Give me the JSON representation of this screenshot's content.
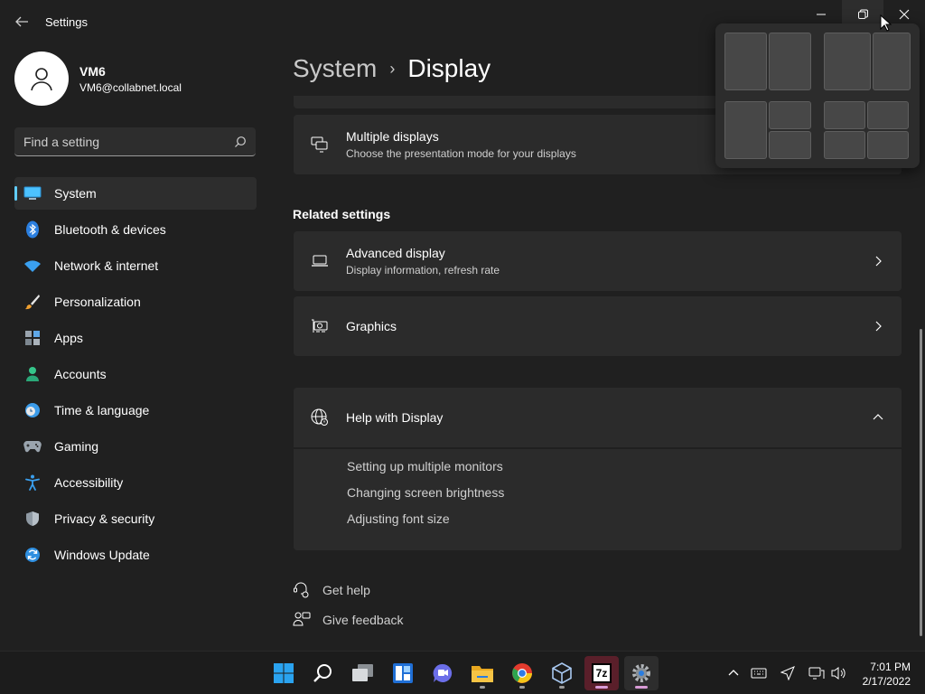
{
  "window": {
    "title": "Settings"
  },
  "profile": {
    "name": "VM6",
    "email": "VM6@collabnet.local"
  },
  "search": {
    "placeholder": "Find a setting"
  },
  "sidebar": {
    "items": [
      {
        "label": "System",
        "icon": "system-icon",
        "selected": true
      },
      {
        "label": "Bluetooth & devices",
        "icon": "bluetooth-icon"
      },
      {
        "label": "Network & internet",
        "icon": "wifi-icon"
      },
      {
        "label": "Personalization",
        "icon": "brush-icon"
      },
      {
        "label": "Apps",
        "icon": "apps-icon"
      },
      {
        "label": "Accounts",
        "icon": "accounts-icon"
      },
      {
        "label": "Time & language",
        "icon": "clock-globe-icon"
      },
      {
        "label": "Gaming",
        "icon": "gamepad-icon"
      },
      {
        "label": "Accessibility",
        "icon": "accessibility-icon"
      },
      {
        "label": "Privacy & security",
        "icon": "shield-icon"
      },
      {
        "label": "Windows Update",
        "icon": "update-icon"
      }
    ]
  },
  "breadcrumb": {
    "parent": "System",
    "separator": "›",
    "current": "Display"
  },
  "cards": {
    "multiple_displays": {
      "title": "Multiple displays",
      "subtitle": "Choose the presentation mode for your displays"
    },
    "advanced_display": {
      "title": "Advanced display",
      "subtitle": "Display information, refresh rate"
    },
    "graphics": {
      "title": "Graphics"
    },
    "help": {
      "title": "Help with Display",
      "links": [
        "Setting up multiple monitors",
        "Changing screen brightness",
        "Adjusting font size"
      ]
    }
  },
  "related_settings": {
    "title": "Related settings"
  },
  "footer": {
    "get_help": "Get help",
    "give_feedback": "Give feedback"
  },
  "taskbar": {
    "apps": [
      "start-icon",
      "search-icon",
      "task-view-icon",
      "widgets-icon",
      "teams-chat-icon",
      "file-explorer-icon",
      "chrome-icon",
      "virtualbox-icon",
      "7zip-icon",
      "settings-icon"
    ],
    "sevenzip_label": "7z"
  },
  "clock": {
    "time": "7:01 PM",
    "date": "2/17/2022"
  },
  "colors": {
    "accent": "#60cdff",
    "background": "#202020",
    "card": "#2b2b2b"
  }
}
